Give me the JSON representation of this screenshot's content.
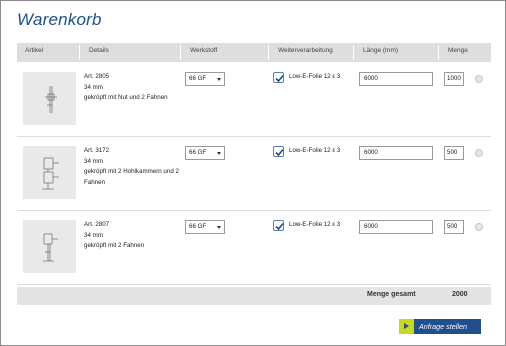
{
  "page": {
    "title": "Warenkorb"
  },
  "table": {
    "headers": [
      "Artikel",
      "Details",
      "Werkstoff",
      "Weiterverarbeitung",
      "Länge (mm)",
      "Menge"
    ],
    "rows": [
      {
        "art": "Art. 2805",
        "dim": "34 mm",
        "desc": "gekröpft mit Nut und 2 Fahnen",
        "material": "66 GF",
        "processing": "Low-E-Folie 12 ε 3",
        "processing_checked": true,
        "length": "6000",
        "quantity": "1000"
      },
      {
        "art": "Art. 3172",
        "dim": "34 mm",
        "desc": "gekröpft mit 2 Hohlkammern und 2 Fahnen",
        "material": "66 GF",
        "processing": "Low-E-Folie 12 ε 3",
        "processing_checked": true,
        "length": "6000",
        "quantity": "500"
      },
      {
        "art": "Art. 2807",
        "dim": "34 mm",
        "desc": "gekröpft mit 2 Fahnen",
        "material": "66 GF",
        "processing": "Low-E-Folie 12 ε 3",
        "processing_checked": true,
        "length": "6000",
        "quantity": "500"
      }
    ]
  },
  "total": {
    "label": "Menge gesamt",
    "value": "2000"
  },
  "submit": {
    "label": "Anfrage stellen"
  },
  "colors": {
    "title": "#1b4f8f",
    "button": "#1f4f8c",
    "button_accent": "#c9d917",
    "header_bg": "#dedede"
  },
  "icons": {
    "dropdown": "chevron-down-icon",
    "checkbox": "checkmark-icon",
    "remove": "remove-icon",
    "submit": "arrow-right-icon"
  }
}
